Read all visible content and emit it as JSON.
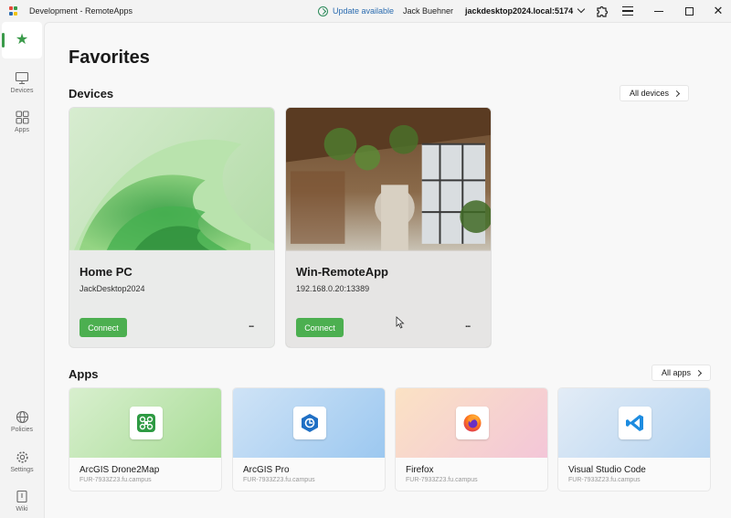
{
  "window": {
    "title": "Development - RemoteApps",
    "update_label": "Update available",
    "user_name": "Jack Buehner",
    "host": "jackdesktop2024.local:5174"
  },
  "colors": {
    "accent": "#3a9a4a",
    "connect": "#4caf50",
    "link": "#2b6cb0"
  },
  "sidebar": {
    "items": [
      {
        "name": "favorites",
        "label": "",
        "icon": "star-icon"
      },
      {
        "name": "devices",
        "label": "Devices",
        "icon": "monitor-icon"
      },
      {
        "name": "apps",
        "label": "Apps",
        "icon": "apps-grid-icon"
      },
      {
        "name": "policies",
        "label": "Policies",
        "icon": "globe-icon"
      },
      {
        "name": "settings",
        "label": "Settings",
        "icon": "gear-icon"
      },
      {
        "name": "wiki",
        "label": "Wiki",
        "icon": "book-icon"
      }
    ]
  },
  "main": {
    "title": "Favorites",
    "devices_section": {
      "title": "Devices",
      "all_label": "All devices",
      "cards": [
        {
          "name": "Home PC",
          "address": "JackDesktop2024",
          "connect_label": "Connect",
          "more_label": "..."
        },
        {
          "name": "Win-RemoteApp",
          "address": "192.168.0.20:13389",
          "connect_label": "Connect",
          "more_label": "..."
        }
      ]
    },
    "apps_section": {
      "title": "Apps",
      "all_label": "All apps",
      "cards": [
        {
          "name": "ArcGIS Drone2Map",
          "host": "FUR-7933Z23.fu.campus",
          "icon": "drone2map-icon"
        },
        {
          "name": "ArcGIS Pro",
          "host": "FUR-7933Z23.fu.campus",
          "icon": "arcgis-pro-icon"
        },
        {
          "name": "Firefox",
          "host": "FUR-7933Z23.fu.campus",
          "icon": "firefox-icon"
        },
        {
          "name": "Visual Studio Code",
          "host": "FUR-7933Z23.fu.campus",
          "icon": "vscode-icon"
        }
      ]
    }
  }
}
